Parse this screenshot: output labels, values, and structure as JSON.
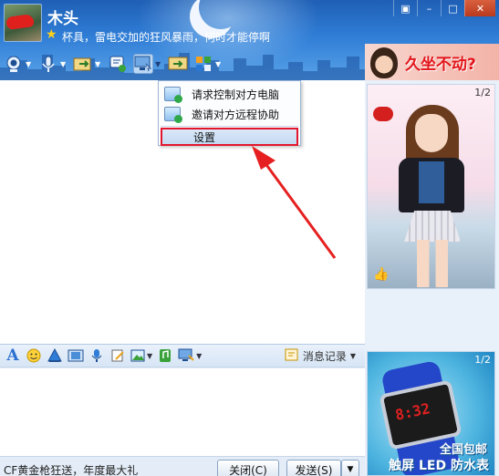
{
  "header": {
    "nickname": "木头",
    "signature": "杯具，雷电交加的狂风暴雨，何时才能停啊",
    "window_buttons": [
      "▣",
      "–",
      "□",
      "✕"
    ]
  },
  "toolbar": {
    "items": [
      {
        "name": "video-call",
        "icon": "webcam-icon"
      },
      {
        "name": "voice-call",
        "icon": "microphone-icon"
      },
      {
        "name": "send-file",
        "icon": "file-transfer-icon"
      },
      {
        "name": "send-sms",
        "icon": "sms-icon"
      },
      {
        "name": "remote-assist",
        "icon": "remote-desktop-icon"
      },
      {
        "name": "share-screen",
        "icon": "screen-share-icon"
      },
      {
        "name": "apps",
        "icon": "apps-grid-icon"
      }
    ]
  },
  "ads": {
    "top_banner": "久坐不动?",
    "girl_counter": "1/2",
    "watch_counter": "1/2",
    "watch_line1": "全国包邮",
    "watch_line2": "触屏 LED 防水表",
    "watch_digits": "8:32"
  },
  "menu": {
    "items": [
      {
        "label": "请求控制对方电脑"
      },
      {
        "label": "邀请对方远程协助"
      },
      {
        "label": "设置"
      }
    ]
  },
  "input_toolbar": {
    "font_label": "A",
    "message_record": "消息记录"
  },
  "bottom": {
    "ad_text": "CF黄金枪狂送，年度最大礼",
    "close_button": "关闭(C)",
    "send_button": "发送(S)",
    "send_dropdown": "▼"
  },
  "colors": {
    "header_top": "#1f5fb5",
    "highlight_border": "#e3152d",
    "annotation_arrow": "#e62020"
  }
}
